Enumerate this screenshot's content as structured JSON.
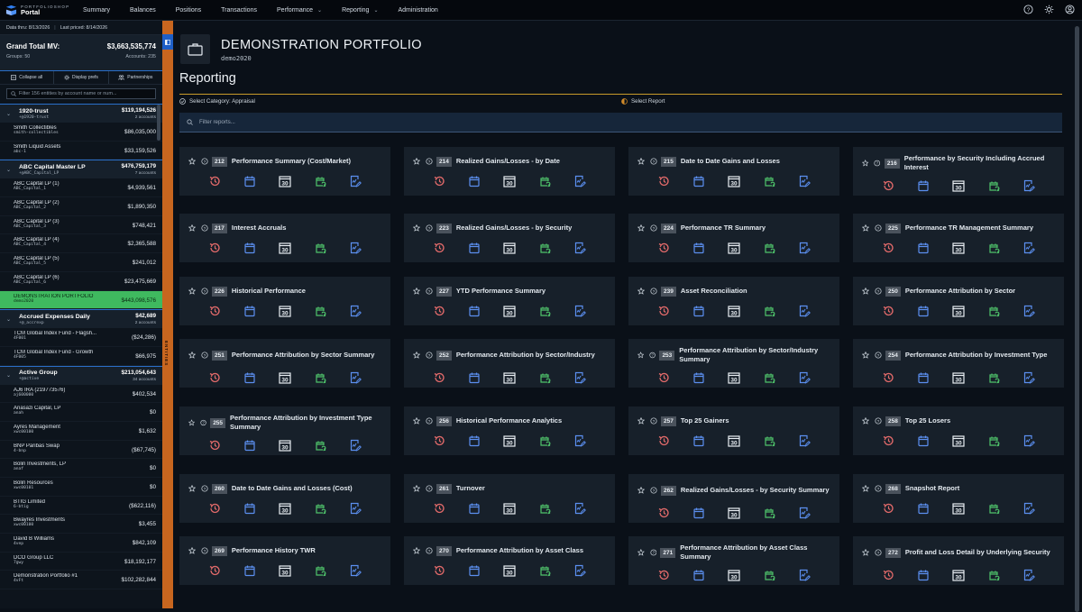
{
  "app": {
    "logo_small": "PORTFOLIOSHOP",
    "logo_main": "Portal"
  },
  "nav": [
    {
      "label": "Summary",
      "dropdown": false
    },
    {
      "label": "Balances",
      "dropdown": false
    },
    {
      "label": "Positions",
      "dropdown": false
    },
    {
      "label": "Transactions",
      "dropdown": false
    },
    {
      "label": "Performance",
      "dropdown": true
    },
    {
      "label": "Reporting",
      "dropdown": true
    },
    {
      "label": "Administration",
      "dropdown": false
    }
  ],
  "sidebar": {
    "data_thru": "Data thru: 8/13/2026",
    "last_priced": "Last priced: 8/14/2026",
    "grand_total_label": "Grand Total MV:",
    "grand_total_value": "$3,663,535,774",
    "groups": "Groups: 50",
    "accounts": "Accounts: 235",
    "collapse_label": "Collapse all",
    "display_label": "Display prefs",
    "partnerships_label": "Partnerships",
    "filter_placeholder": "Filter 156 entities by account name or num...",
    "handle_label": "ENTITIES",
    "list": [
      {
        "type": "group",
        "name": "1920-trust",
        "code": "+@1920-trust",
        "amount": "$119,194,526",
        "count": "2 accounts"
      },
      {
        "type": "account",
        "name": "Smith Collectibles",
        "code": "smith-collectibles",
        "amount": "$86,035,000"
      },
      {
        "type": "account",
        "name": "Smith Liquid Assets",
        "code": "abc-1",
        "amount": "$33,159,526"
      },
      {
        "type": "group",
        "name": "ABC Capital Master LP",
        "code": "+@ABC_Capital_LP",
        "amount": "$476,759,179",
        "count": "7 accounts"
      },
      {
        "type": "account",
        "name": "ABC Capital LP (1)",
        "code": "ABC_Capital_1",
        "amount": "$4,939,561"
      },
      {
        "type": "account",
        "name": "ABC Capital LP (2)",
        "code": "ABC_Capital_2",
        "amount": "$1,890,350"
      },
      {
        "type": "account",
        "name": "ABC Capital LP (3)",
        "code": "ABC_Capital_3",
        "amount": "$748,421"
      },
      {
        "type": "account",
        "name": "ABC Capital LP (4)",
        "code": "ABC_Capital_4",
        "amount": "$2,365,588"
      },
      {
        "type": "account",
        "name": "ABC Capital LP (5)",
        "code": "ABC_Capital_5",
        "amount": "$241,012"
      },
      {
        "type": "account",
        "name": "ABC Capital LP (6)",
        "code": "ABC_Capital_6",
        "amount": "$23,475,669"
      },
      {
        "type": "account",
        "name": "DEMONSTRATION PORTFOLIO",
        "code": "demo2020",
        "amount": "$443,098,576",
        "selected": true
      },
      {
        "type": "group",
        "name": "Accrued Expenses Daily",
        "code": "+@_accrexp",
        "amount": "$42,689",
        "count": "2 accounts"
      },
      {
        "type": "account",
        "name": "TCM Global Index Fund - Flagsh...",
        "code": "4F001",
        "amount": "($24,286)"
      },
      {
        "type": "account",
        "name": "TCM Global Index Fund - Growth",
        "code": "4F005",
        "amount": "$66,975"
      },
      {
        "type": "group",
        "name": "Active Group",
        "code": "+@active",
        "amount": "$213,054,643",
        "count": "34 accounts"
      },
      {
        "type": "account",
        "name": "AJ6 IRA (219773576)",
        "code": "aj600000",
        "amount": "$402,534"
      },
      {
        "type": "account",
        "name": "Anasazi Capital, LP",
        "code": "anah",
        "amount": "$0"
      },
      {
        "type": "account",
        "name": "Ayres Management",
        "code": "xwc00100",
        "amount": "$1,632"
      },
      {
        "type": "account",
        "name": "BNP Paribas Swap",
        "code": "4-bnp",
        "amount": "($67,745)"
      },
      {
        "type": "account",
        "name": "Bolin Investments, LP",
        "code": "anaf",
        "amount": "$0"
      },
      {
        "type": "account",
        "name": "Bolin Resources",
        "code": "xwc00101",
        "amount": "$0"
      },
      {
        "type": "account",
        "name": "BTIG Limited",
        "code": "6-btig",
        "amount": "($622,116)"
      },
      {
        "type": "account",
        "name": "Bwayres Investments",
        "code": "xwc00100",
        "amount": "$3,455"
      },
      {
        "type": "account",
        "name": "David B Williams",
        "code": "4vep",
        "amount": "$842,109"
      },
      {
        "type": "account",
        "name": "DCO Group LLC",
        "code": "7gwy",
        "amount": "$18,192,177"
      },
      {
        "type": "account",
        "name": "Demonstration Portfolio #1",
        "code": "4vFt",
        "amount": "$102,282,844"
      }
    ]
  },
  "main": {
    "portfolio_title": "DEMONSTRATION PORTFOLIO",
    "portfolio_code": "demo2020",
    "reporting_title": "Reporting",
    "step1": "Select Category: Appraisal",
    "step2": "Select Report",
    "search_placeholder": "Filter reports...",
    "reports": [
      {
        "num": "212",
        "title": "Performance Summary (Cost/Market)"
      },
      {
        "num": "214",
        "title": "Realized Gains/Losses - by Date"
      },
      {
        "num": "215",
        "title": "Date to Date Gains and Losses"
      },
      {
        "num": "216",
        "title": "Performance by Security Including Accrued Interest"
      },
      {
        "num": "217",
        "title": "Interest Accruals"
      },
      {
        "num": "223",
        "title": "Realized Gains/Losses - by Security"
      },
      {
        "num": "224",
        "title": "Performance TR Summary"
      },
      {
        "num": "225",
        "title": "Performance TR Management Summary"
      },
      {
        "num": "226",
        "title": "Historical Performance"
      },
      {
        "num": "227",
        "title": "YTD Performance Summary"
      },
      {
        "num": "239",
        "title": "Asset Reconciliation"
      },
      {
        "num": "250",
        "title": "Performance Attribution by Sector"
      },
      {
        "num": "251",
        "title": "Performance Attribution by Sector Summary"
      },
      {
        "num": "252",
        "title": "Performance Attribution by Sector/Industry"
      },
      {
        "num": "253",
        "title": "Performance Attribution by Sector/Industry Summary"
      },
      {
        "num": "254",
        "title": "Performance Attribution by Investment Type"
      },
      {
        "num": "255",
        "title": "Performance Attribution by Investment Type Summary"
      },
      {
        "num": "256",
        "title": "Historical Performance Analytics"
      },
      {
        "num": "257",
        "title": "Top 25 Gainers"
      },
      {
        "num": "258",
        "title": "Top 25 Losers"
      },
      {
        "num": "260",
        "title": "Date to Date Gains and Losses (Cost)"
      },
      {
        "num": "261",
        "title": "Turnover"
      },
      {
        "num": "262",
        "title": "Realized Gains/Losses - by Security Summary"
      },
      {
        "num": "268",
        "title": "Snapshot Report"
      },
      {
        "num": "269",
        "title": "Performance History TWR"
      },
      {
        "num": "270",
        "title": "Performance Attribution by Asset Class"
      },
      {
        "num": "271",
        "title": "Performance Attribution by Asset Class Summary"
      },
      {
        "num": "272",
        "title": "Profit and Loss Detail by Underlying Security"
      }
    ],
    "calendar_day": "30"
  },
  "icons": {
    "card": [
      "history-icon",
      "calendar-icon",
      "calendar-30-icon",
      "calendar-refresh-icon",
      "report-edit-icon"
    ],
    "top": [
      "help-icon",
      "settings-icon",
      "user-icon"
    ]
  },
  "colors": {
    "accent_blue": "#2a6fc9",
    "selected_green": "#3fb95f",
    "handle_orange": "#c8661f",
    "divider_gold": "#c89a2a",
    "icon_red": "#e26a6a",
    "icon_blue": "#5b8ff0",
    "icon_green": "#4fc36b"
  }
}
